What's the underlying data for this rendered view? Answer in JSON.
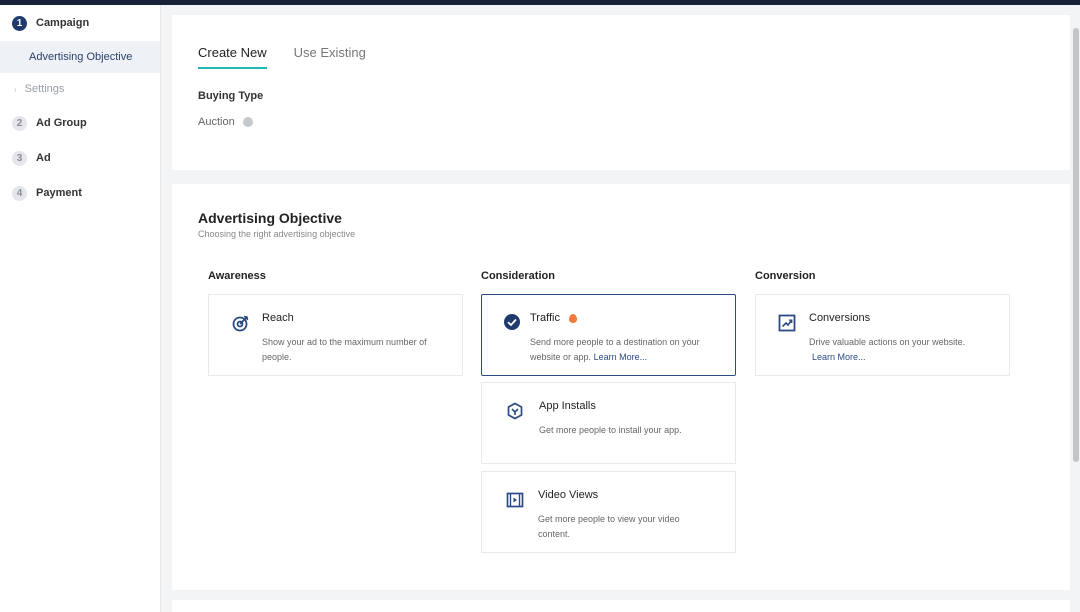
{
  "sidebar": {
    "steps": [
      {
        "num": "1",
        "label": "Campaign"
      },
      {
        "num": "2",
        "label": "Ad Group"
      },
      {
        "num": "3",
        "label": "Ad"
      },
      {
        "num": "4",
        "label": "Payment"
      }
    ],
    "active_sub": "Advertising Objective",
    "sub_settings": "Settings"
  },
  "tabs": [
    "Create New",
    "Use Existing"
  ],
  "buying_type": {
    "title": "Buying Type",
    "value": "Auction"
  },
  "objective": {
    "title": "Advertising Objective",
    "subtitle": "Choosing the right advertising objective",
    "columns": [
      "Awareness",
      "Consideration",
      "Conversion"
    ],
    "cards": {
      "reach": {
        "title": "Reach",
        "desc": "Show your ad to the maximum number of people."
      },
      "traffic": {
        "title": "Traffic",
        "desc": "Send more people to a destination on your website or app.",
        "link": "Learn More..."
      },
      "conversions": {
        "title": "Conversions",
        "desc": "Drive valuable actions on your website.",
        "link": "Learn More..."
      },
      "app_installs": {
        "title": "App Installs",
        "desc": "Get more people to install your app."
      },
      "video_views": {
        "title": "Video Views",
        "desc": "Get more people to view your video content."
      }
    }
  },
  "colors": {
    "accent": "#1fb8b4",
    "primary": "#1f3b6e",
    "selected_border": "#2a4b84"
  },
  "icons": [
    "reach-icon",
    "check-circle-icon",
    "flame-icon",
    "conversions-icon",
    "app-installs-icon",
    "video-views-icon",
    "info-icon"
  ]
}
